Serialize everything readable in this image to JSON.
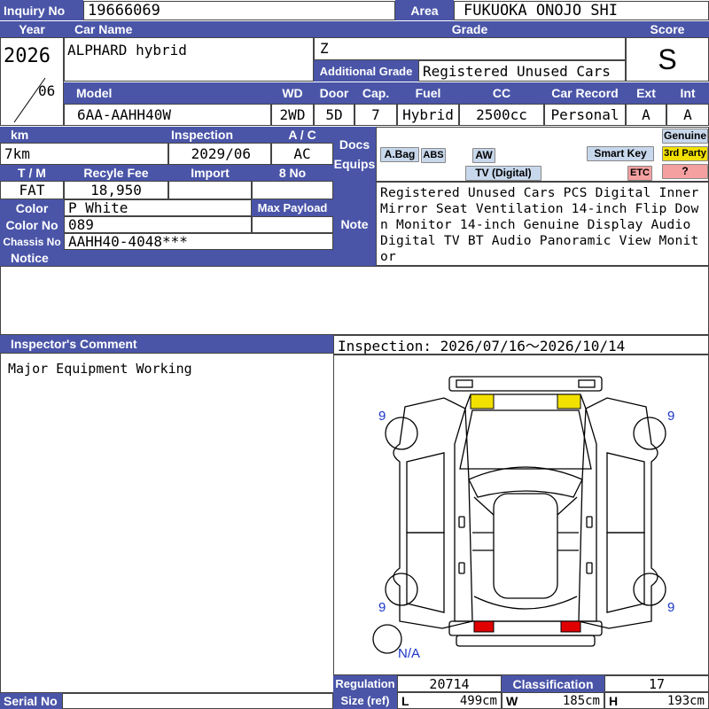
{
  "header": {
    "inquiry_label": "Inquiry No",
    "inquiry_no": "19666069",
    "area_label": "Area",
    "area": "FUKUOKA ONOJO SHI"
  },
  "row1": {
    "year_label": "Year",
    "year": "2026",
    "month": "06",
    "car_name_label": "Car Name",
    "car_name": "ALPHARD hybrid",
    "grade_label": "Grade",
    "grade": "Z",
    "additional_grade_label": "Additional Grade",
    "additional_grade": "Registered Unused Cars",
    "score_label": "Score",
    "score": "S"
  },
  "row2": {
    "model_label": "Model",
    "model": "6AA-AAHH40W",
    "wd_label": "WD",
    "wd": "2WD",
    "door_label": "Door",
    "door": "5D",
    "cap_label": "Cap.",
    "cap": "7",
    "fuel_label": "Fuel",
    "fuel": "Hybrid",
    "cc_label": "CC",
    "cc": "2500cc",
    "record_label": "Car Record",
    "record": "Personal",
    "ext_label": "Ext",
    "ext": "A",
    "int_label": "Int",
    "int": "A"
  },
  "row3": {
    "km_label": "km",
    "km": "7km",
    "inspection_label": "Inspection",
    "inspection": "2029/06",
    "ac_label": "A / C",
    "ac": "AC",
    "docs_label": "Docs",
    "equips_label": "Equips",
    "tm_label": "T / M",
    "tm": "FAT",
    "recycle_label": "Recyle Fee",
    "recycle": "18,950",
    "import_label": "Import",
    "import": "",
    "eightno_label": "8 No",
    "eightno": "",
    "color_label": "Color",
    "color": "P White",
    "max_payload_label": "Max Payload",
    "max_payload": "",
    "color_no_label": "Color No",
    "color_no": "089",
    "chassis_label": "Chassis No",
    "chassis": "AAHH40-4048***",
    "notice_label": "Notice",
    "notice": "",
    "note_label": "Note",
    "note": "Registered Unused Cars PCS Digital Inner Mirror Seat Ventilation 14-inch Flip Down Monitor 14-inch Genuine Display Audio Digital TV BT Audio Panoramic View Monitor"
  },
  "equips": {
    "genuine": "Genuine",
    "third_party": "3rd Party",
    "unknown": "?",
    "abag": "A.Bag",
    "abs": "ABS",
    "aw": "AW",
    "smart_key": "Smart Key",
    "tv": "TV (Digital)",
    "etc": "ETC"
  },
  "comment": {
    "label": "Inspector's Comment",
    "text": "Major Equipment Working",
    "inspection_period": "Inspection: 2026/07/16～2026/10/14"
  },
  "diagram": {
    "tire_fl": "9",
    "tire_fr": "9",
    "tire_rl": "9",
    "tire_rr": "9",
    "spare": "N/A"
  },
  "footer": {
    "regulation_label": "Regulation",
    "regulation": "20714",
    "classification_label": "Classification",
    "classification": "17",
    "size_label": "Size (ref)",
    "l_label": "L",
    "l": "499cm",
    "w_label": "W",
    "w": "185cm",
    "h_label": "H",
    "h": "193cm",
    "serial_label": "Serial No",
    "serial": ""
  },
  "colors": {
    "header_bg": "#4a55a8",
    "equip_bg": "#c8d8ec",
    "third_party": "#f2e000",
    "unknown": "#f4a0a0",
    "tire_numbers": "#1a36c8",
    "damage_yellow": "#f2e000",
    "damage_red": "#e00000"
  }
}
